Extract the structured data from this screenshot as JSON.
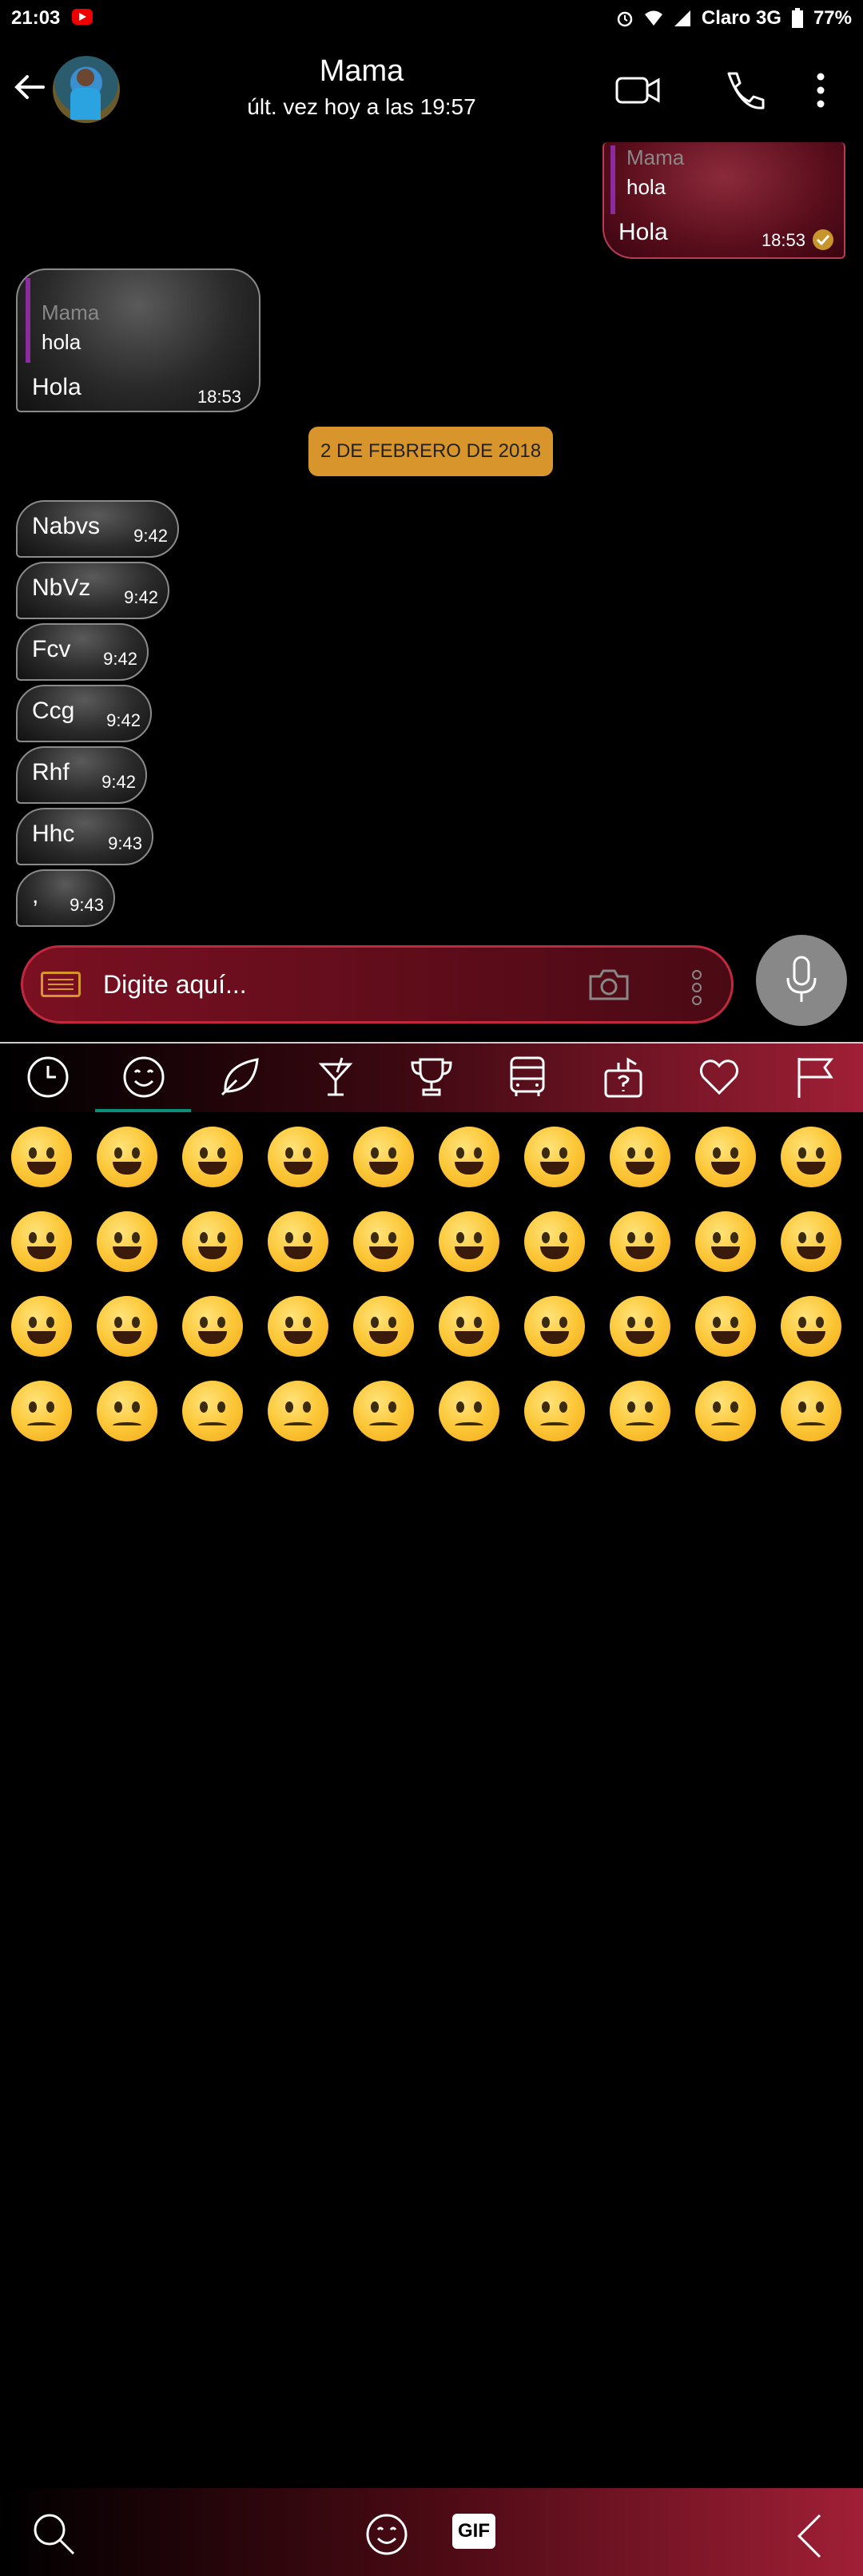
{
  "status_bar": {
    "time": "21:03",
    "carrier": "Claro 3G",
    "battery": "77%"
  },
  "header": {
    "contact_name": "Mama",
    "last_seen": "últ. vez hoy a las 19:57"
  },
  "messages": [
    {
      "side": "out",
      "quote_name": "Mama",
      "quote_text": "hola",
      "text": "Hola",
      "time": "18:53"
    },
    {
      "side": "in",
      "quote_name": "Mama",
      "quote_text": "hola",
      "text": "Hola",
      "time": "18:53"
    },
    {
      "type": "date",
      "text": "2 DE FEBRERO DE 2018"
    },
    {
      "side": "in",
      "text": "Nabvs",
      "time": "9:42"
    },
    {
      "side": "in",
      "text": "NbVz",
      "time": "9:42"
    },
    {
      "side": "in",
      "text": "Fcv",
      "time": "9:42"
    },
    {
      "side": "in",
      "text": "Ccg",
      "time": "9:42"
    },
    {
      "side": "in",
      "text": "Rhf",
      "time": "9:42"
    },
    {
      "side": "in",
      "text": "Hhc",
      "time": "9:43"
    },
    {
      "side": "in",
      "text": ",",
      "time": "9:43"
    }
  ],
  "composer": {
    "placeholder": "Digite aquí..."
  },
  "emoji_categories": [
    "recent-icon",
    "smileys-icon",
    "nature-icon",
    "food-drink-icon",
    "activity-icon",
    "travel-icon",
    "objects-icon",
    "symbols-icon",
    "flags-icon"
  ],
  "emoji_selected_category": "smileys-icon",
  "bottom_bar": {
    "gif_label": "GIF"
  },
  "colors": {
    "accent": "#d8952b",
    "bubble_out": "#7a1022",
    "tab_indicator": "#0a8f7a"
  }
}
